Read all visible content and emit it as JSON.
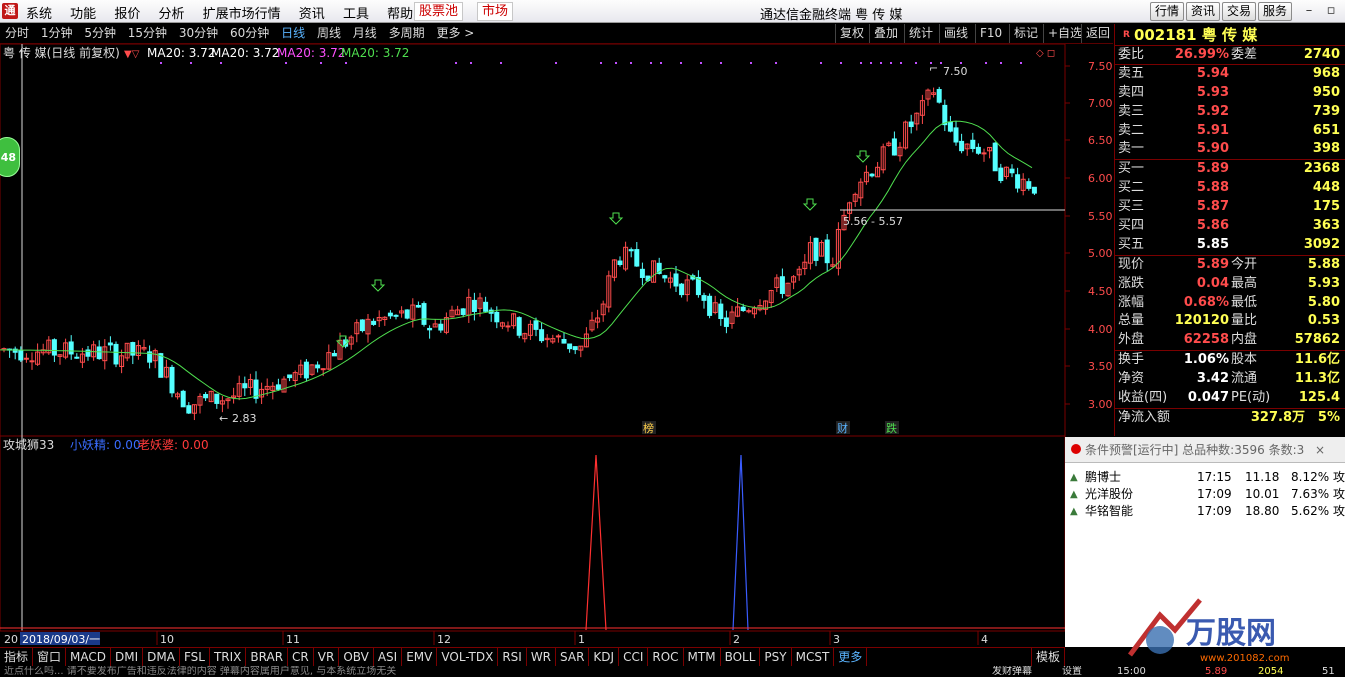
{
  "menubar": {
    "logo": "通",
    "items": [
      "系统",
      "功能",
      "报价",
      "分析",
      "扩展市场行情",
      "资讯",
      "工具",
      "帮助"
    ],
    "stock_pool": "股票池",
    "market": "市场",
    "title": "通达信金融终端  粤 传 媒",
    "right_buttons": [
      "行情",
      "资讯",
      "交易",
      "服务"
    ]
  },
  "periods": [
    "分时",
    "1分钟",
    "5分钟",
    "15分钟",
    "30分钟",
    "60分钟",
    "日线",
    "周线",
    "月线",
    "多周期",
    "更多 >"
  ],
  "active_period": "日线",
  "chart_tools": [
    "复权",
    "叠加",
    "统计",
    "画线",
    "F10",
    "标记",
    "+自选",
    "返回"
  ],
  "main_chart": {
    "title": "粤 传 媒(日线 前复权)",
    "ma_labels": [
      {
        "text": "MA20: 3.72",
        "color": "#ffffff"
      },
      {
        "text": "MA20: 3.72",
        "color": "#ffffff"
      },
      {
        "text": "MA20: 3.72",
        "color": "#ff50ff"
      },
      {
        "text": "MA20: 3.72",
        "color": "#4fdf4f"
      }
    ],
    "price_ticks": [
      "7.50",
      "7.00",
      "6.50",
      "6.00",
      "5.50",
      "5.00",
      "4.50",
      "4.00",
      "3.50",
      "3.00"
    ],
    "high_label": "7.50",
    "low_label": "2.83",
    "hline_label": "5.56 - 5.57",
    "event_tags": [
      "榜",
      "财",
      "跌"
    ]
  },
  "sub_chart": {
    "title": "攻城狮33",
    "series": [
      {
        "text": "小妖精: 0.00",
        "color": "#3a6cff"
      },
      {
        "text": "老妖婆: 0.00",
        "color": "#ff3a3a"
      }
    ]
  },
  "time_axis": {
    "prefix": "20",
    "cursor_date": "2018/09/03/一",
    "months": [
      "10",
      "11",
      "12",
      "1",
      "2",
      "3",
      "4"
    ]
  },
  "indicators": [
    "指标",
    "窗口",
    "MACD",
    "DMI",
    "DMA",
    "FSL",
    "TRIX",
    "BRAR",
    "CR",
    "VR",
    "OBV",
    "ASI",
    "EMV",
    "VOL-TDX",
    "RSI",
    "WR",
    "SAR",
    "KDJ",
    "CCI",
    "ROC",
    "MTM",
    "BOLL",
    "PSY",
    "MCST",
    "更多"
  ],
  "indicator_template": "模板",
  "left_badge": "48",
  "quote": {
    "code": "002181",
    "name": "粤 传 媒",
    "weibi_label": "委比",
    "weibi": "26.99%",
    "weicha_label": "委差",
    "weicha": "2740",
    "asks": [
      {
        "label": "卖五",
        "price": "5.94",
        "vol": "968"
      },
      {
        "label": "卖四",
        "price": "5.93",
        "vol": "950"
      },
      {
        "label": "卖三",
        "price": "5.92",
        "vol": "739"
      },
      {
        "label": "卖二",
        "price": "5.91",
        "vol": "651"
      },
      {
        "label": "卖一",
        "price": "5.90",
        "vol": "398"
      }
    ],
    "bids": [
      {
        "label": "买一",
        "price": "5.89",
        "vol": "2368"
      },
      {
        "label": "买二",
        "price": "5.88",
        "vol": "448"
      },
      {
        "label": "买三",
        "price": "5.87",
        "vol": "175"
      },
      {
        "label": "买四",
        "price": "5.86",
        "vol": "363"
      },
      {
        "label": "买五",
        "price": "5.85",
        "vol": "3092"
      }
    ],
    "stats": [
      {
        "l1": "现价",
        "v1": "5.89",
        "c1": "red",
        "l2": "今开",
        "v2": "5.88",
        "c2": "red"
      },
      {
        "l1": "涨跌",
        "v1": "0.04",
        "c1": "red",
        "l2": "最高",
        "v2": "5.93",
        "c2": "red"
      },
      {
        "l1": "涨幅",
        "v1": "0.68%",
        "c1": "red",
        "l2": "最低",
        "v2": "5.80",
        "c2": "green"
      },
      {
        "l1": "总量",
        "v1": "120120",
        "c1": "yellow",
        "l2": "量比",
        "v2": "0.53",
        "c2": "green"
      },
      {
        "l1": "外盘",
        "v1": "62258",
        "c1": "red",
        "l2": "内盘",
        "v2": "57862",
        "c2": "green"
      }
    ],
    "stats2": [
      {
        "l1": "换手",
        "v1": "1.06%",
        "c1": "white",
        "l2": "股本",
        "v2": "11.6亿",
        "c2": "white"
      },
      {
        "l1": "净资",
        "v1": "3.42",
        "c1": "white",
        "l2": "流通",
        "v2": "11.3亿",
        "c2": "white"
      },
      {
        "l1": "收益(四)",
        "v1": "0.047",
        "c1": "white",
        "l2": "PE(动)",
        "v2": "125.4",
        "c2": "white"
      }
    ],
    "net_inflow_label": "净流入额",
    "net_inflow": "327.8万",
    "net_inflow_pct": "5%"
  },
  "alerts": {
    "title": "条件预警[运行中] 总品种数:3596 条数:3",
    "rows": [
      {
        "name": "鹏博士",
        "time": "17:15",
        "price": "11.18",
        "chg": "8.12%",
        "extra": "攻"
      },
      {
        "name": "光洋股份",
        "time": "17:09",
        "price": "10.01",
        "chg": "7.63%",
        "extra": "攻"
      },
      {
        "name": "华铭智能",
        "time": "17:09",
        "price": "18.80",
        "chg": "5.62%",
        "extra": "攻"
      }
    ]
  },
  "status": {
    "left": "近点什么吗...  请不要发布广告和违反法律的内容  弹幕内容属用户意见, 与本系统立场无关",
    "mid1": "发财弹幕",
    "mid2": "设置",
    "bottom_time": "15:00",
    "bottom_price": "5.89",
    "bottom_vol": "2054",
    "bottom_n": "51"
  },
  "watermark": {
    "brand": "万股网",
    "url": "www.201082.com"
  },
  "colors": {
    "up": "#ff4c4c",
    "down": "#54ffff",
    "ma": "#4fdf4f",
    "bg": "#000000",
    "frame": "#7a0000"
  }
}
